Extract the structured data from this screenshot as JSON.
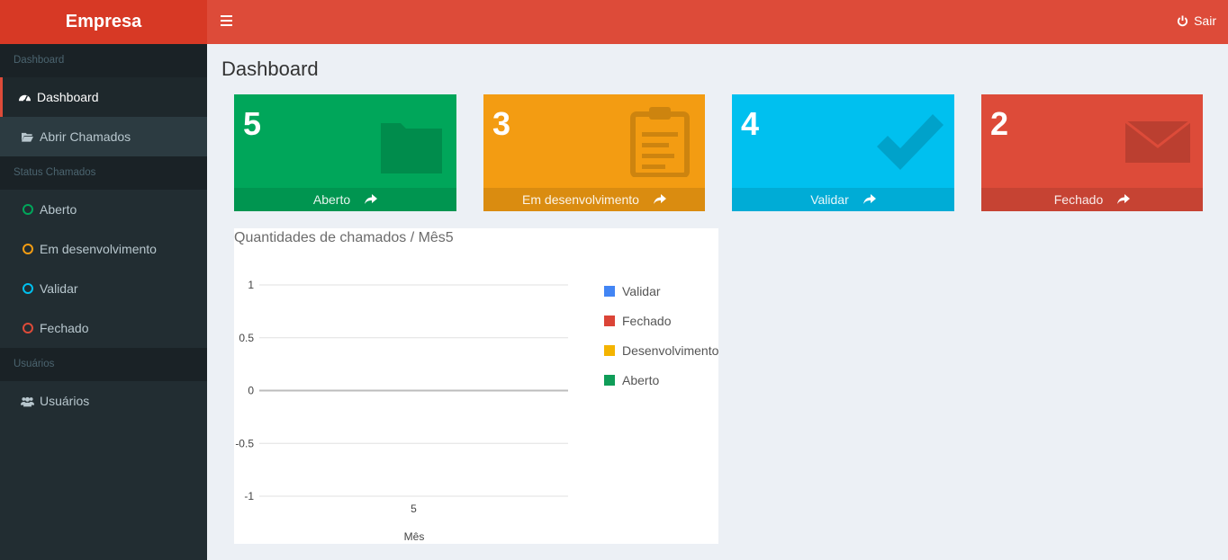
{
  "brand": "Empresa",
  "header": {
    "logout_label": "Sair"
  },
  "sidebar": {
    "sections": [
      {
        "header": "Dashboard",
        "items": [
          {
            "label": "Dashboard",
            "icon": "dashboard-icon"
          },
          {
            "label": "Abrir Chamados",
            "icon": "folder-open-icon"
          }
        ]
      },
      {
        "header": "Status Chamados",
        "items": [
          {
            "label": "Aberto",
            "icon": "circle-icon",
            "color": "#00a65a"
          },
          {
            "label": "Em desenvolvimento",
            "icon": "circle-icon",
            "color": "#f39c12"
          },
          {
            "label": "Validar",
            "icon": "circle-icon",
            "color": "#00c0ef"
          },
          {
            "label": "Fechado",
            "icon": "circle-icon",
            "color": "#dd4b39"
          }
        ]
      },
      {
        "header": "Usuários",
        "items": [
          {
            "label": "Usuários",
            "icon": "users-icon"
          }
        ]
      }
    ]
  },
  "page_title": "Dashboard",
  "boxes": [
    {
      "count": "5",
      "label": "Aberto",
      "color": "#00a65a",
      "icon": "folder-icon"
    },
    {
      "count": "3",
      "label": "Em desenvolvimento",
      "color": "#f39c12",
      "icon": "clipboard-icon"
    },
    {
      "count": "4",
      "label": "Validar",
      "color": "#00c0ef",
      "icon": "check-icon"
    },
    {
      "count": "2",
      "label": "Fechado",
      "color": "#dd4b39",
      "icon": "envelope-icon"
    }
  ],
  "chart_data": {
    "type": "bar",
    "title": "Quantidades de chamados / Mês5",
    "xlabel": "Mês",
    "ylabel": "",
    "categories": [
      "5"
    ],
    "ylim": [
      -1,
      1
    ],
    "yticks": [
      "1",
      "0.5",
      "0",
      "-0.5",
      "-1"
    ],
    "series": [
      {
        "name": "Validar",
        "color": "#4285f4",
        "values": [
          0
        ]
      },
      {
        "name": "Fechado",
        "color": "#db4437",
        "values": [
          0
        ]
      },
      {
        "name": "Desenvolvimento",
        "color": "#f4b400",
        "values": [
          0
        ]
      },
      {
        "name": "Aberto",
        "color": "#0f9d58",
        "values": [
          0
        ]
      }
    ],
    "legend": "right",
    "grid": true
  }
}
